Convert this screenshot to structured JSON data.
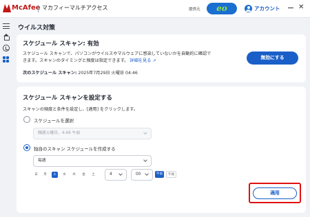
{
  "app": {
    "brand": "McAfee",
    "title": "マカフィーマルチアクセス",
    "provider_label": "提供元",
    "provider_logo": "eo",
    "account_label": "アカウント",
    "minimize_icon": "minimize-icon",
    "close_symbol": "✕"
  },
  "sidebar": {
    "items": [
      {
        "icon": "menu-icon"
      },
      {
        "icon": "home-icon"
      },
      {
        "icon": "shield-icon"
      },
      {
        "icon": "grid-icon",
        "active": true
      }
    ]
  },
  "page": {
    "title": "ウイルス対策"
  },
  "status_card": {
    "title": "スケジュール スキャン: 有効",
    "body_line1": "スケジュール スキャンで、パソコンがウイルスやマルウェアに感染していないかを自動的に確認で",
    "body_line2": "きます。スキャンのタイミングと頻度は指定できます。",
    "detail_link": "詳細を見る",
    "next_scan_label": "次のスケジュール スキャン:",
    "next_scan_value": "2025年7月29日 火曜日 04:46",
    "disable_button": "無効にする"
  },
  "settings_card": {
    "title": "スケジュール スキャンを設定する",
    "description": "スキャンの頻度と条件を設定し、[適用] をクリックします。",
    "option_preset_label": "スケジュールを選択",
    "preset_select_value": "隔週火曜日、4:46 午前",
    "option_custom_label": "独自のスキャン スケジュールを作成する",
    "frequency_value": "毎週",
    "days": [
      "日",
      "月",
      "火",
      "水",
      "木",
      "金",
      "土"
    ],
    "selected_day_index": 2,
    "hour_value": "4",
    "minute_value": "00",
    "am_label": "午前",
    "pm_label": "午後",
    "apply_button": "適用"
  },
  "colors": {
    "accent": "#1a5fc8",
    "brand_red": "#c01818",
    "highlight": "#e01010"
  }
}
